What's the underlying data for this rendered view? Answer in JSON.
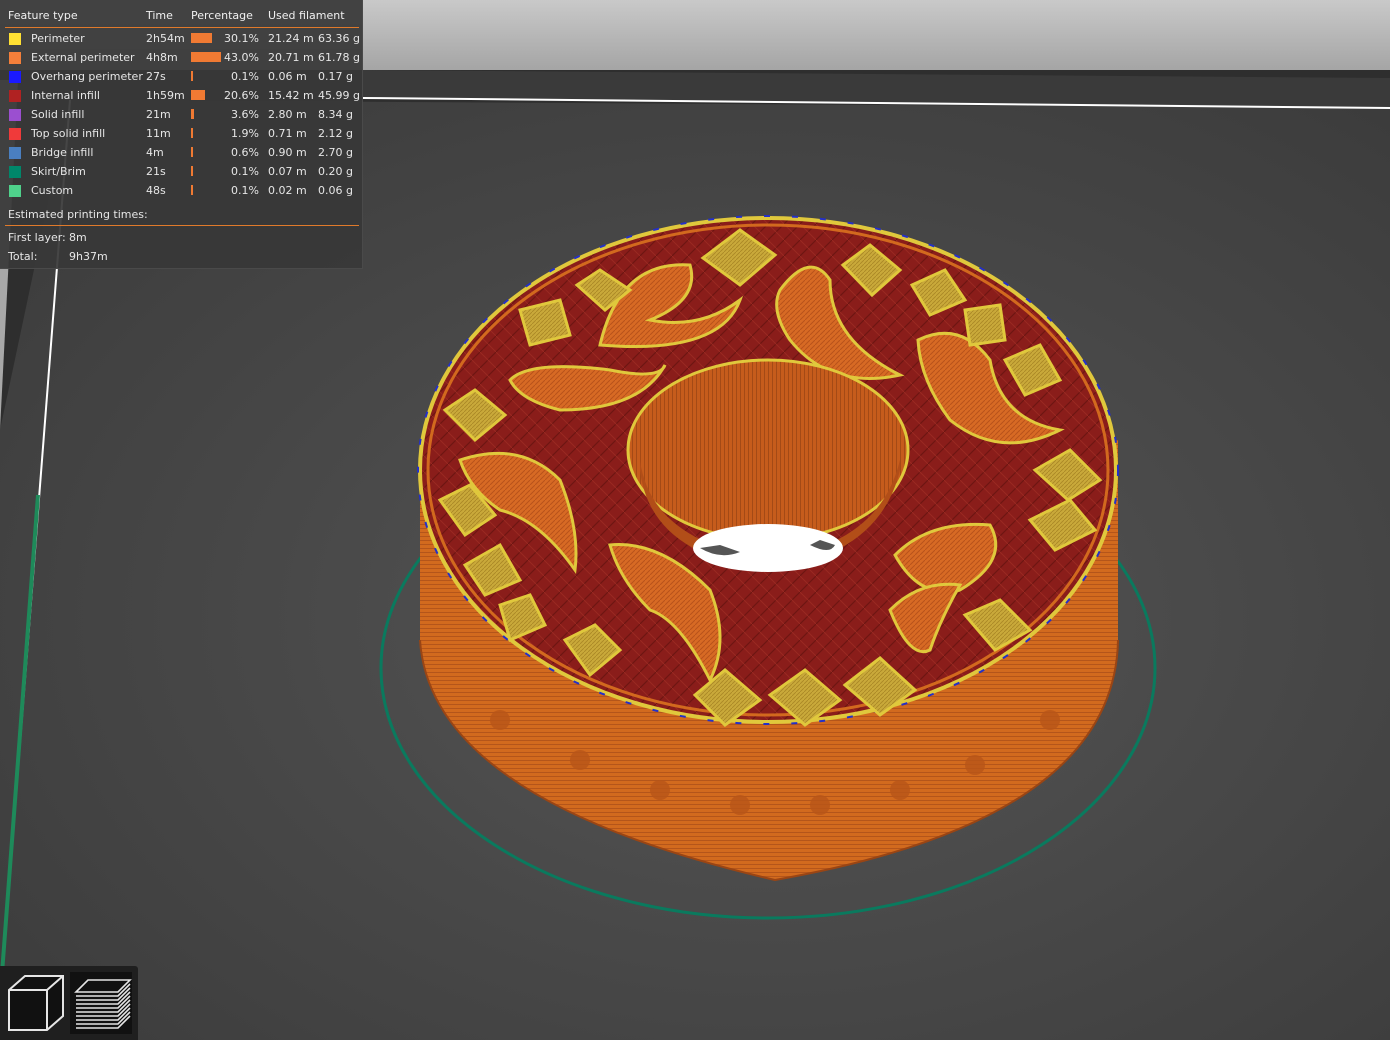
{
  "legend": {
    "headers": {
      "feature_type": "Feature type",
      "time": "Time",
      "percentage": "Percentage",
      "used_filament": "Used filament"
    },
    "rows": [
      {
        "color": "#ffe033",
        "name": "Perimeter",
        "time": "2h54m",
        "percent": "30.1%",
        "pct_value": 30.1,
        "length": "21.24 m",
        "weight": "63.36 g"
      },
      {
        "color": "#f47f3a",
        "name": "External perimeter",
        "time": "4h8m",
        "percent": "43.0%",
        "pct_value": 43.0,
        "length": "20.71 m",
        "weight": "61.78 g"
      },
      {
        "color": "#1a1aff",
        "name": "Overhang perimeter",
        "time": "27s",
        "percent": "0.1%",
        "pct_value": 0.1,
        "length": "0.06 m",
        "weight": "0.17 g"
      },
      {
        "color": "#b02222",
        "name": "Internal infill",
        "time": "1h59m",
        "percent": "20.6%",
        "pct_value": 20.6,
        "length": "15.42 m",
        "weight": "45.99 g"
      },
      {
        "color": "#9b4fd0",
        "name": "Solid infill",
        "time": "21m",
        "percent": "3.6%",
        "pct_value": 3.6,
        "length": "2.80 m",
        "weight": "8.34 g"
      },
      {
        "color": "#f03a3a",
        "name": "Top solid infill",
        "time": "11m",
        "percent": "1.9%",
        "pct_value": 1.9,
        "length": "0.71 m",
        "weight": "2.12 g"
      },
      {
        "color": "#4a7fc0",
        "name": "Bridge infill",
        "time": "4m",
        "percent": "0.6%",
        "pct_value": 0.6,
        "length": "0.90 m",
        "weight": "2.70 g"
      },
      {
        "color": "#00876a",
        "name": "Skirt/Brim",
        "time": "21s",
        "percent": "0.1%",
        "pct_value": 0.1,
        "length": "0.07 m",
        "weight": "0.20 g"
      },
      {
        "color": "#4fd18b",
        "name": "Custom",
        "time": "48s",
        "percent": "0.1%",
        "pct_value": 0.1,
        "length": "0.02 m",
        "weight": "0.06 g"
      }
    ],
    "estimated_label": "Estimated printing times:",
    "first_layer_label": "First layer:",
    "first_layer_value": "8m",
    "total_label": "Total:",
    "total_value": "9h37m"
  },
  "view_toggle": {
    "items": [
      {
        "icon": "cube-3d-view-icon"
      },
      {
        "icon": "layers-preview-icon"
      }
    ]
  },
  "colors": {
    "background": "#2b2b2b",
    "bed": "#4a4a4a",
    "accent": "#f07a33",
    "object_orange": "#d2691e",
    "infill_red": "#8e1c1c",
    "perimeter_yellow": "#e0c83c",
    "skirt": "#0a7a5e"
  }
}
